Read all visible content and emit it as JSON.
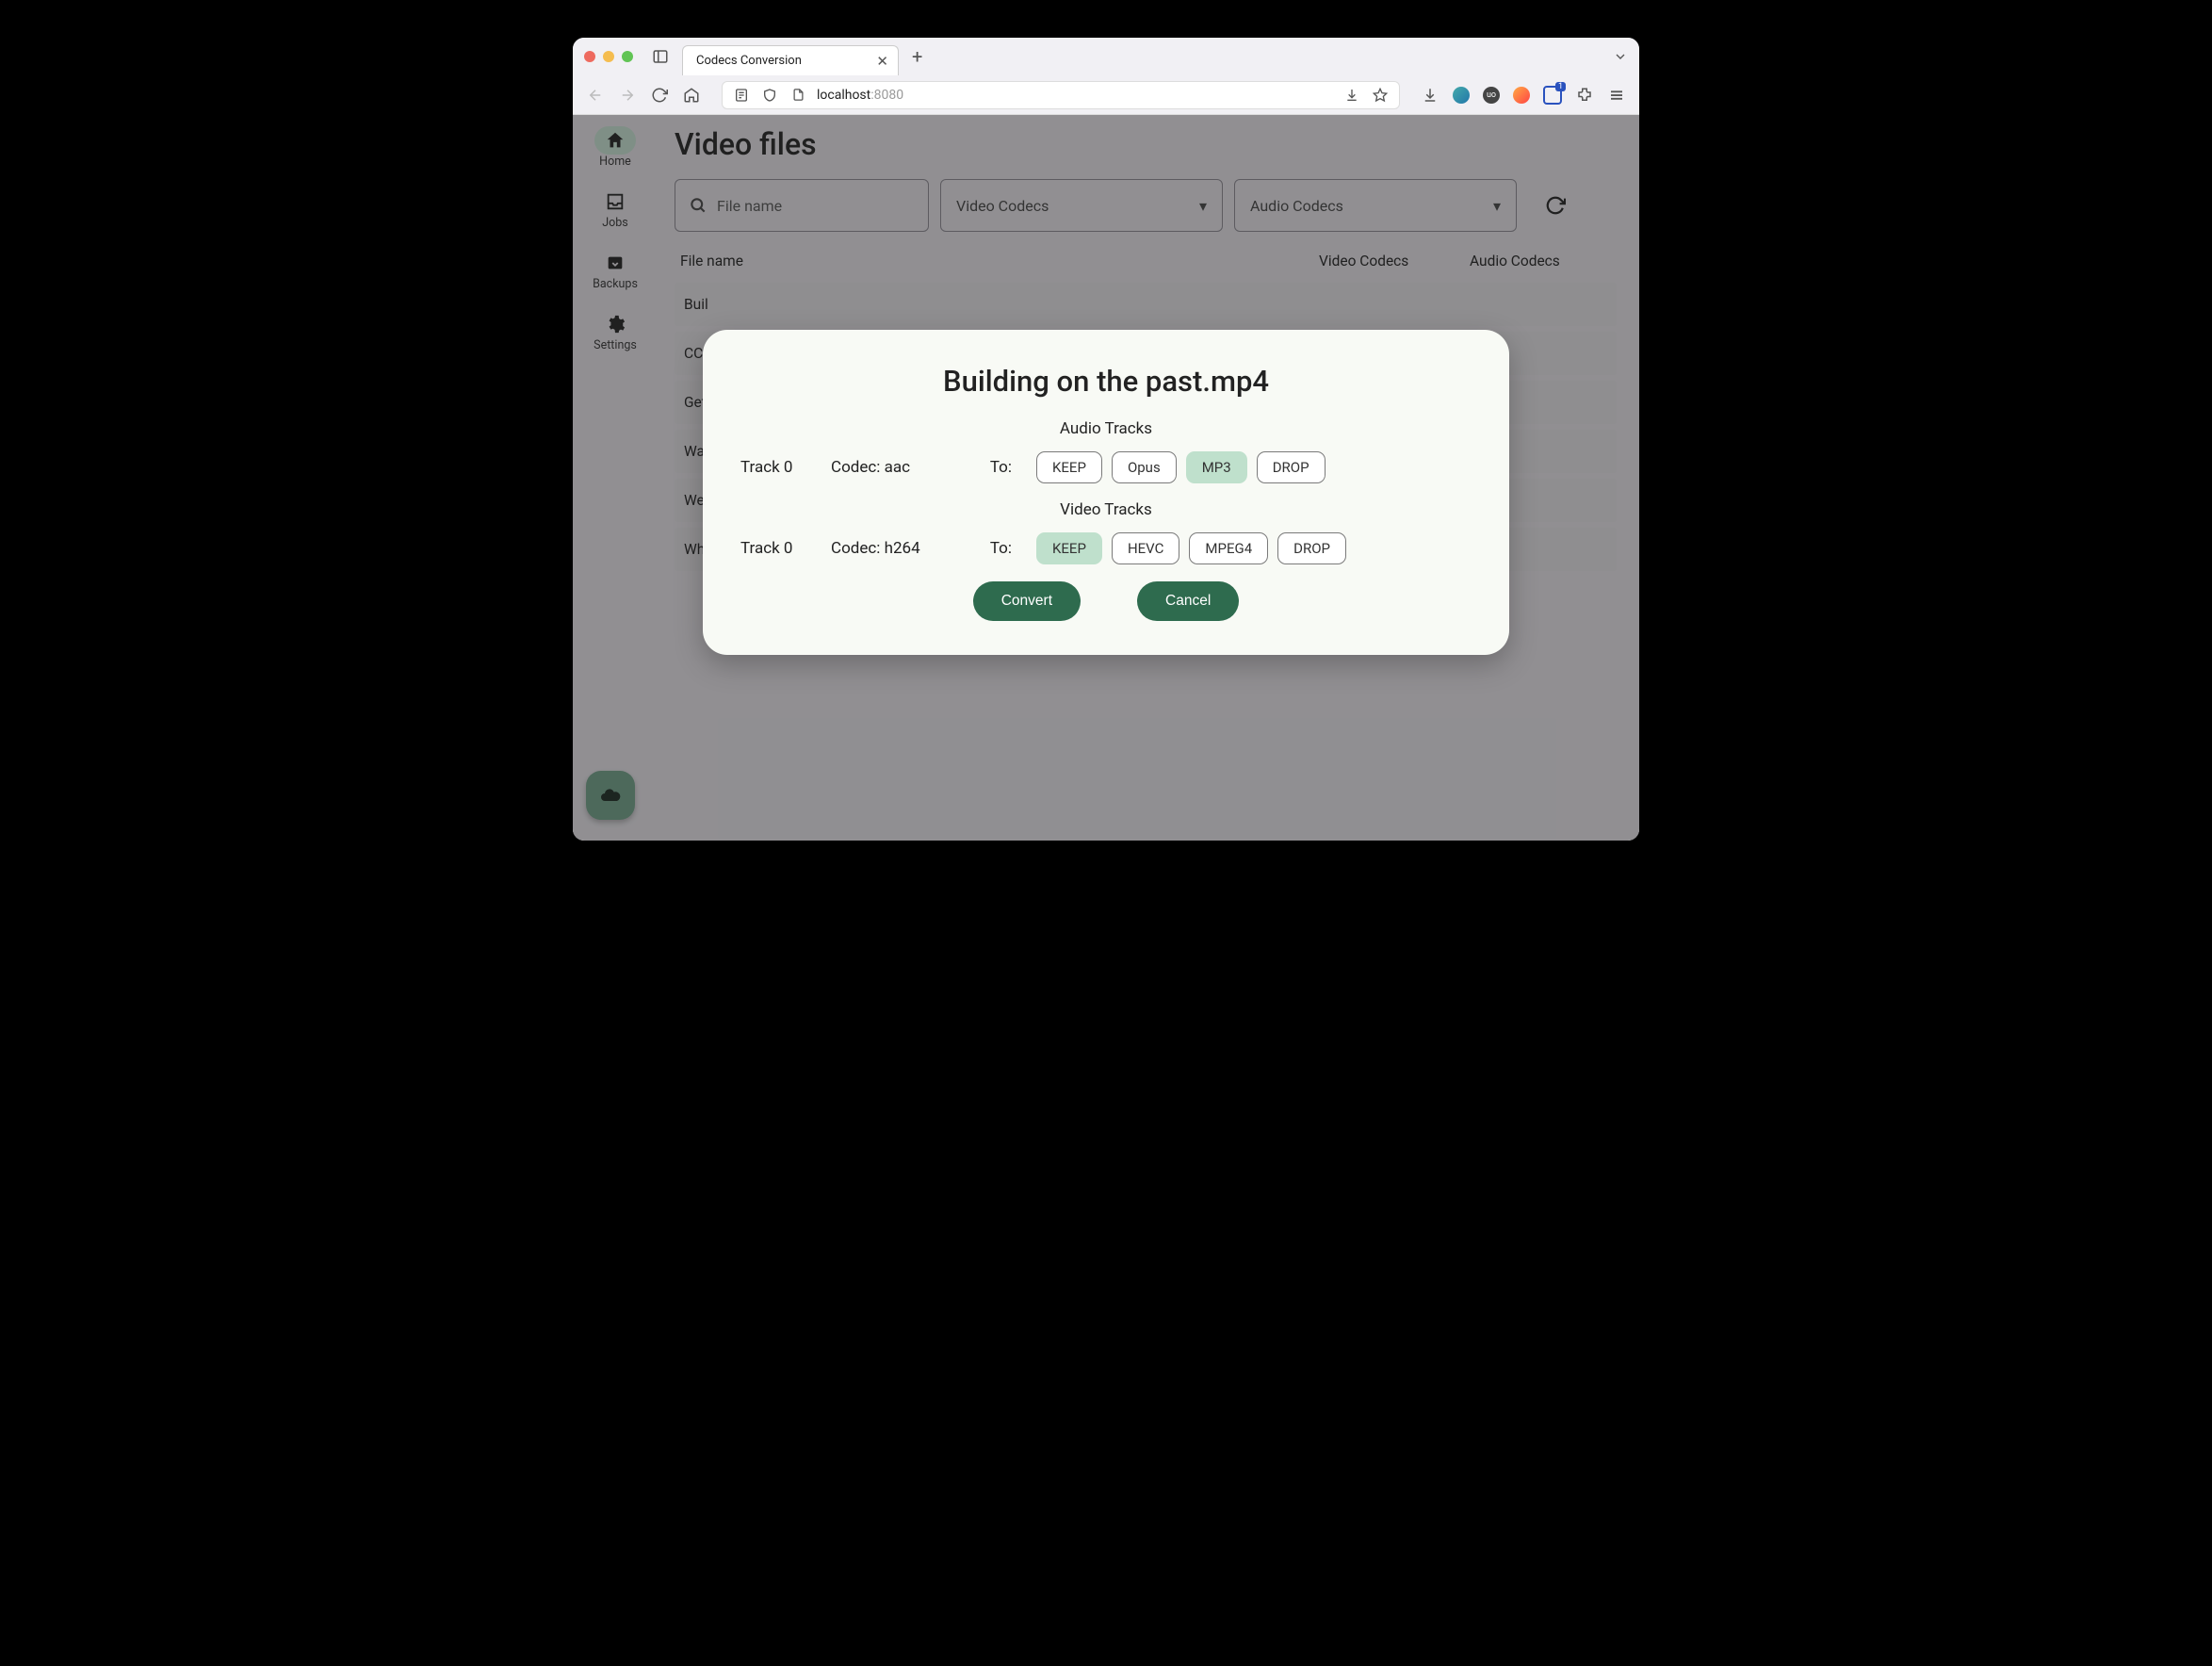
{
  "browser": {
    "tab_title": "Codecs Conversion",
    "url_host": "localhost",
    "url_port": ":8080",
    "ext_badge": "1"
  },
  "sidebar": {
    "items": [
      {
        "label": "Home"
      },
      {
        "label": "Jobs"
      },
      {
        "label": "Backups"
      },
      {
        "label": "Settings"
      }
    ]
  },
  "page": {
    "title": "Video files",
    "search_placeholder": "File name",
    "video_codecs_label": "Video Codecs",
    "audio_codecs_label": "Audio Codecs",
    "columns": {
      "file": "File name",
      "video": "Video Codecs",
      "audio": "Audio Codecs"
    },
    "rows": [
      "Buil",
      "CC+",
      "Get",
      "Wan",
      "Wel",
      "Wha"
    ]
  },
  "dialog": {
    "title": "Building on the past.mp4",
    "audio_section": "Audio Tracks",
    "video_section": "Video Tracks",
    "to_label": "To:",
    "audio_track": {
      "name": "Track 0",
      "codec": "Codec: aac",
      "options": [
        "KEEP",
        "Opus",
        "MP3",
        "DROP"
      ],
      "selected": "MP3"
    },
    "video_track": {
      "name": "Track 0",
      "codec": "Codec: h264",
      "options": [
        "KEEP",
        "HEVC",
        "MPEG4",
        "DROP"
      ],
      "selected": "KEEP"
    },
    "convert": "Convert",
    "cancel": "Cancel"
  }
}
